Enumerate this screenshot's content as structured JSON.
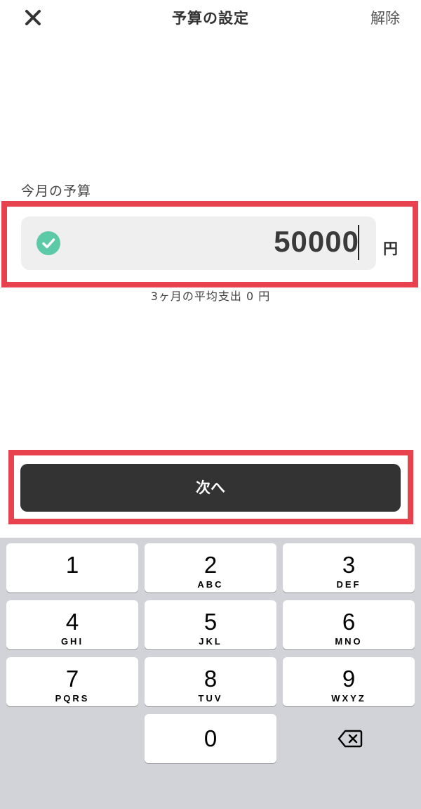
{
  "header": {
    "title": "予算の設定",
    "cancel_label": "解除"
  },
  "budget": {
    "label": "今月の予算",
    "value": "50000",
    "unit": "円",
    "average_text": "3ヶ月の平均支出 0 円"
  },
  "next_button": {
    "label": "次へ"
  },
  "keyboard": {
    "keys": [
      {
        "num": "1",
        "letters": ""
      },
      {
        "num": "2",
        "letters": "ABC"
      },
      {
        "num": "3",
        "letters": "DEF"
      },
      {
        "num": "4",
        "letters": "GHI"
      },
      {
        "num": "5",
        "letters": "JKL"
      },
      {
        "num": "6",
        "letters": "MNO"
      },
      {
        "num": "7",
        "letters": "PQRS"
      },
      {
        "num": "8",
        "letters": "TUV"
      },
      {
        "num": "9",
        "letters": "WXYZ"
      },
      {
        "num": "0",
        "letters": ""
      }
    ]
  },
  "colors": {
    "highlight": "#e8424f",
    "check": "#5cc9a7",
    "button": "#333333",
    "keyboard_bg": "#d1d3d9"
  },
  "icons": {
    "close": "close-icon",
    "check": "check-circle-icon",
    "delete": "backspace-icon"
  }
}
